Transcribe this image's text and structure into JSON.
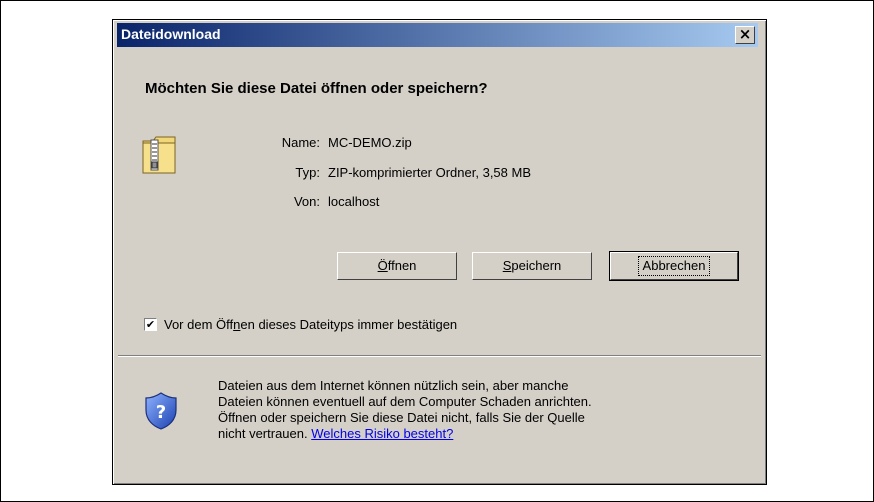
{
  "dialog": {
    "title": "Dateidownload",
    "close_symbol": "×",
    "question": "Möchten Sie diese Datei öffnen oder speichern?",
    "file": {
      "icon": "zip-folder-icon",
      "name_label": "Name:",
      "name_value": "MC-DEMO.zip",
      "type_label": "Typ:",
      "type_value": "ZIP-komprimierter Ordner, 3,58 MB",
      "from_label": "Von:",
      "from_value": "localhost"
    },
    "buttons": {
      "open": {
        "accel": "Ö",
        "rest": "ffnen"
      },
      "save": {
        "accel": "S",
        "rest": "peichern"
      },
      "cancel": "Abbrechen"
    },
    "checkbox": {
      "checked": true,
      "check_symbol": "✔",
      "label_before": "Vor dem Öff",
      "label_accel": "n",
      "label_after": "en dieses Dateityps immer bestätigen"
    },
    "warning": {
      "icon": "security-shield-icon",
      "line1": "Dateien aus dem Internet können nützlich sein, aber manche",
      "line2": "Dateien können eventuell auf dem Computer Schaden anrichten.",
      "line3": "Öffnen oder speichern Sie diese Datei nicht, falls Sie der Quelle",
      "line4_prefix": "nicht vertrauen. ",
      "link": "Welches Risiko besteht?"
    }
  }
}
